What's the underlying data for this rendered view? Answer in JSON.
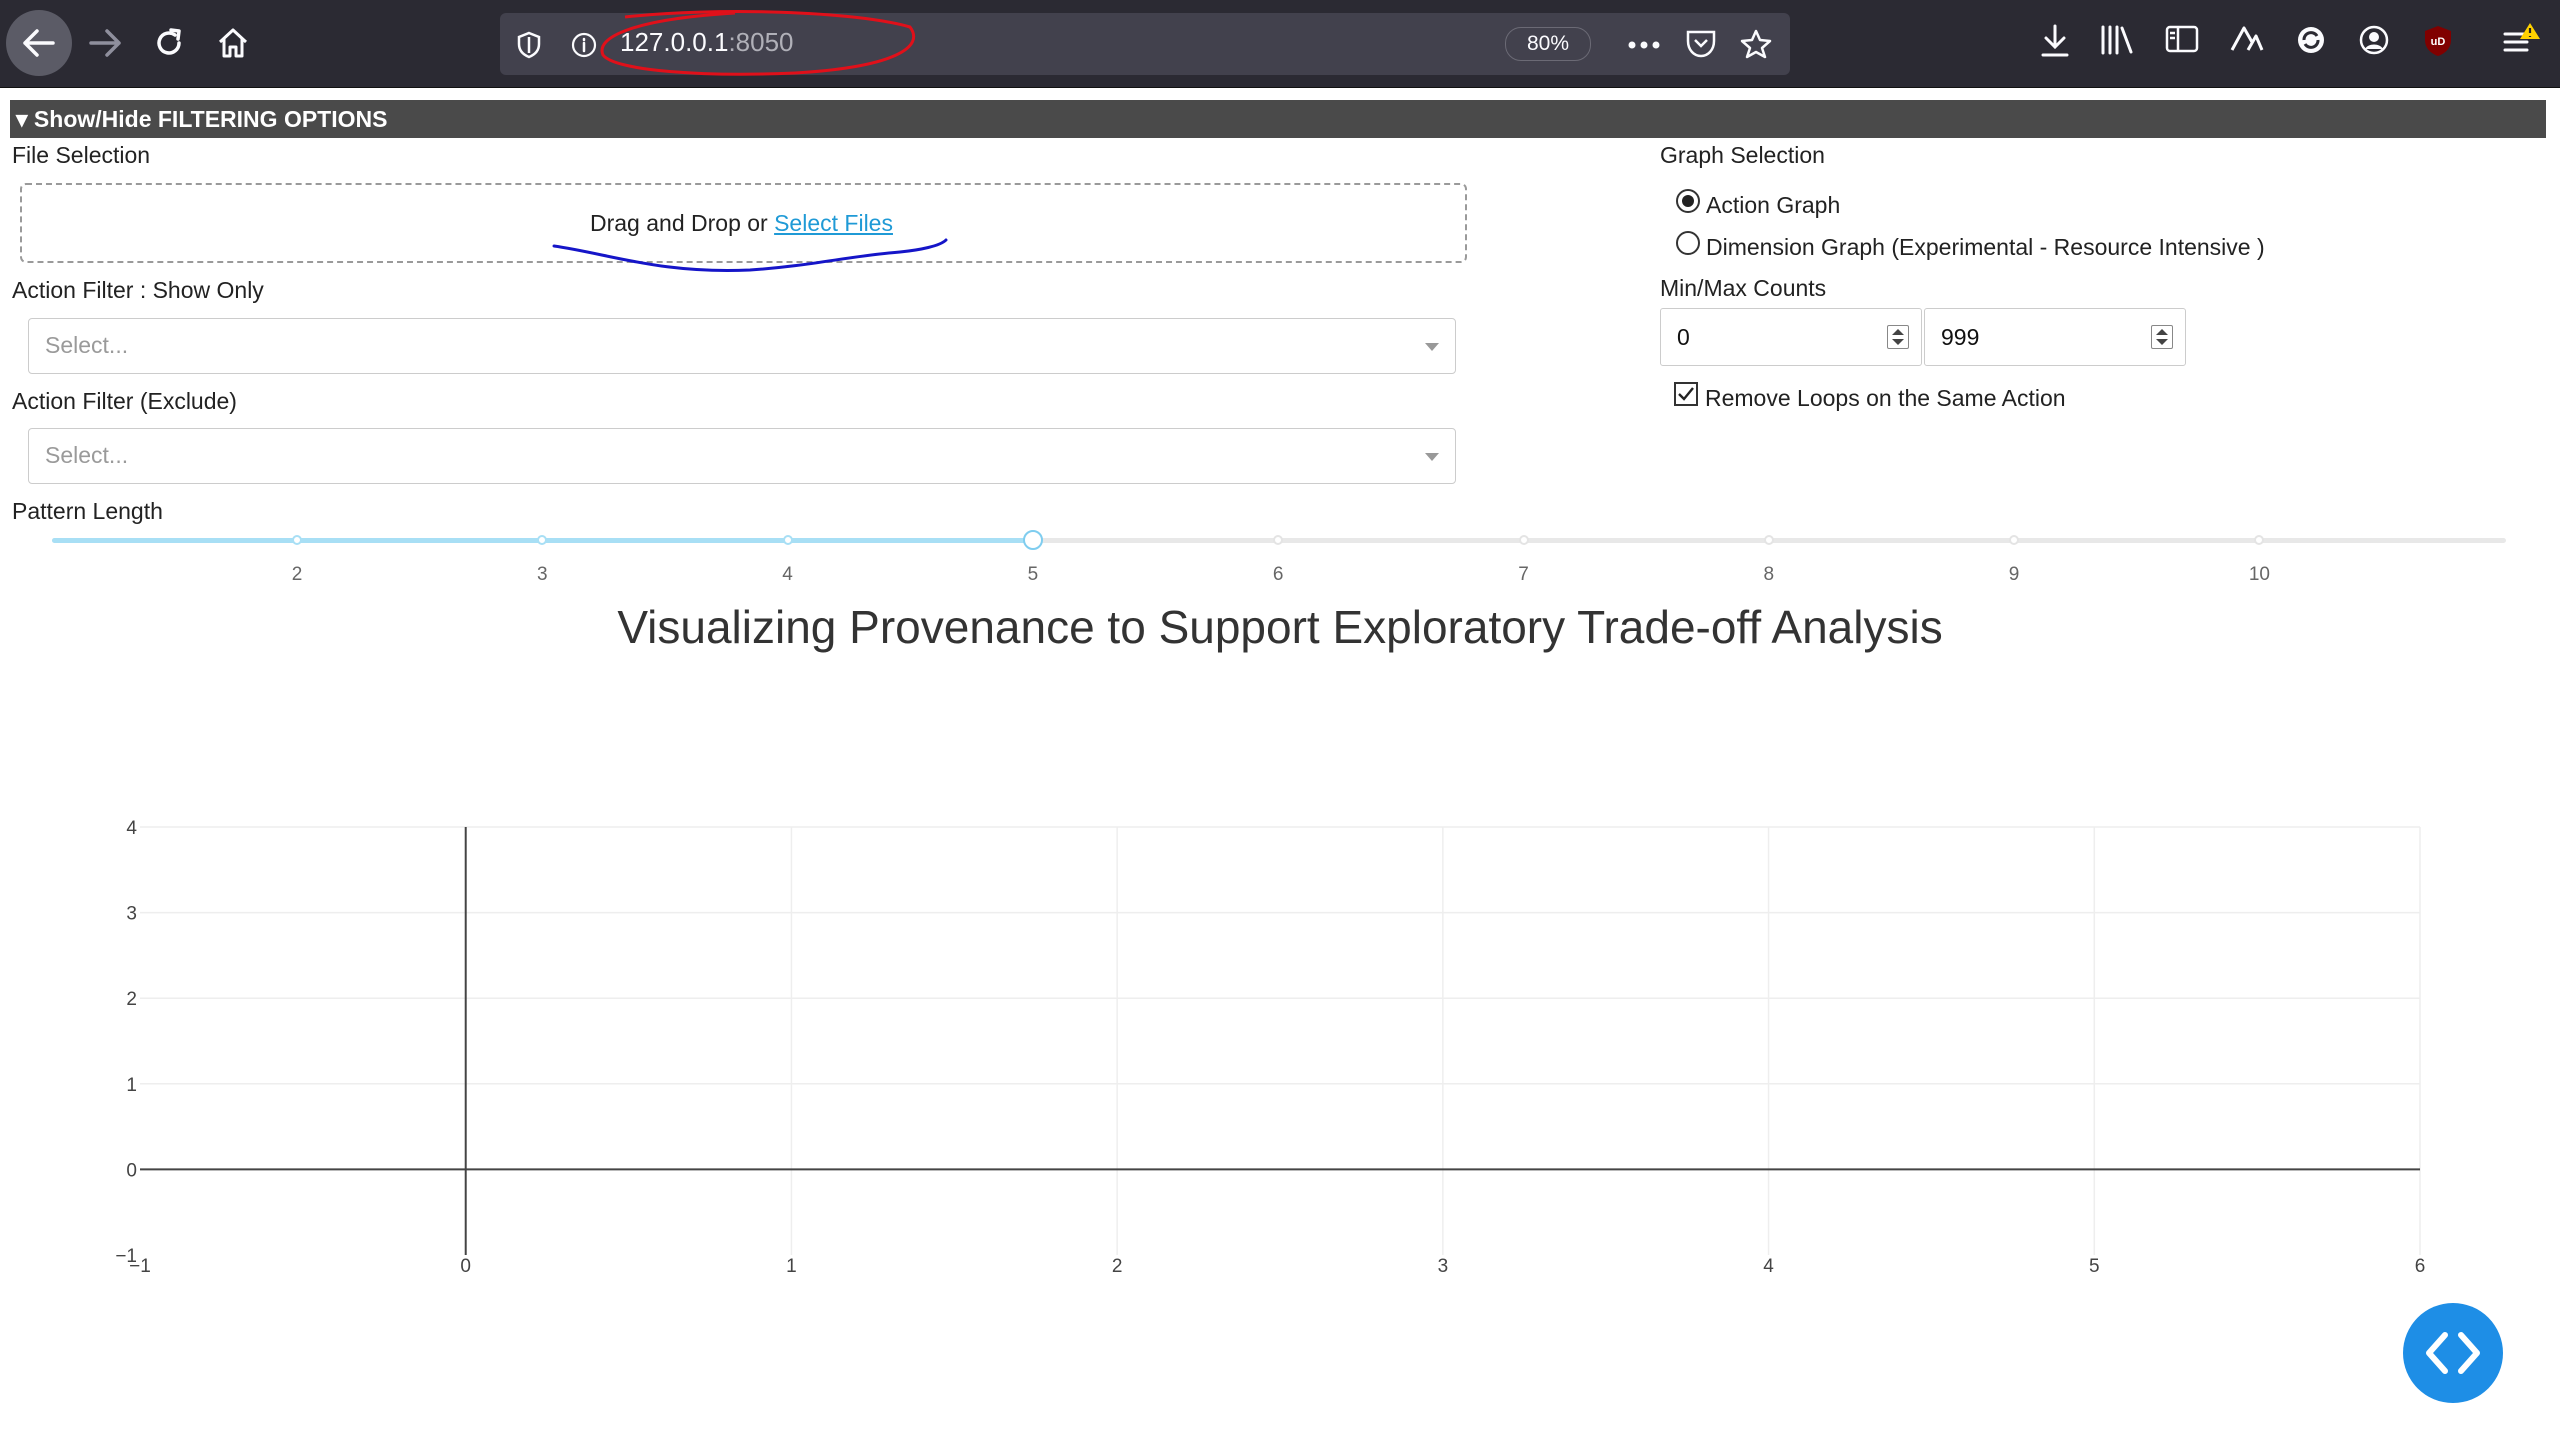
{
  "browser": {
    "url_host": "127.0.0.1",
    "url_port": ":8050",
    "zoom": "80%"
  },
  "filter": {
    "toggle_label": "▾ Show/Hide FILTERING OPTIONS",
    "file_selection_label": "File Selection",
    "upload_text": "Drag and Drop or ",
    "upload_link": "Select Files",
    "action_filter_show_label": "Action Filter : Show Only",
    "action_filter_show_placeholder": "Select...",
    "action_filter_exclude_label": "Action Filter (Exclude)",
    "action_filter_exclude_placeholder": "Select...",
    "pattern_length_label": "Pattern Length",
    "slider": {
      "marks": [
        "2",
        "3",
        "4",
        "5",
        "6",
        "7",
        "8",
        "9",
        "10"
      ],
      "value": 5
    },
    "graph_selection_label": "Graph Selection",
    "radio_options": [
      {
        "label": "Action Graph",
        "selected": true
      },
      {
        "label": "Dimension Graph (Experimental - Resource Intensive )",
        "selected": false
      }
    ],
    "min_max_label": "Min/Max Counts",
    "min_value": "0",
    "max_value": "999",
    "remove_loops_label": "Remove Loops on the Same Action",
    "remove_loops_checked": true
  },
  "graph_title": "Visualizing Provenance to Support Exploratory Trade-off Analysis",
  "chart_data": {
    "type": "scatter",
    "x_ticks": [
      "−1",
      "0",
      "1",
      "2",
      "3",
      "4",
      "5",
      "6"
    ],
    "y_ticks": [
      "−1",
      "0",
      "1",
      "2",
      "3",
      "4"
    ],
    "xlim": [
      -1,
      6
    ],
    "ylim": [
      -1,
      4
    ],
    "series": [],
    "grid": true
  },
  "colors": {
    "accent": "#1f9ad6",
    "slider_fill": "#a8dff5",
    "fab": "#1e8ee6",
    "annotation_red": "#e0101a",
    "annotation_blue": "#1515c8"
  }
}
